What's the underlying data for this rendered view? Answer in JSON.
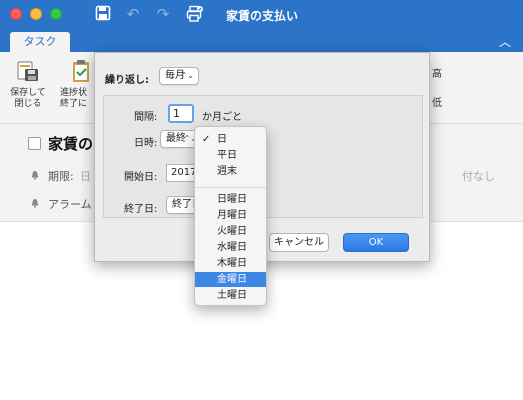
{
  "window": {
    "title": "家賃の支払い"
  },
  "ribbon": {
    "tab": "タスク",
    "save_close_line1": "保存して",
    "save_close_line2": "閉じる",
    "progress_line1": "進捗状",
    "progress_line2": "終了に",
    "priority_high": "高",
    "priority_low": "低",
    "collapse_icon": "chevron-up-icon"
  },
  "task": {
    "title": "家賃の",
    "due_label": "期限:",
    "due_value": "日",
    "due_right": "付なし",
    "alarm_label": "アラーム"
  },
  "dialog": {
    "repeat_label": "繰り返し:",
    "repeat_value": "毎月",
    "interval_label": "間隔:",
    "interval_value": "1",
    "interval_unit": "か月ごと",
    "date_label": "日時:",
    "date_value": "最終",
    "start_label": "開始日:",
    "start_value": "2017/",
    "end_label": "終了日:",
    "end_value": "終了日",
    "cancel_label": "キャンセル",
    "ok_label": "OK"
  },
  "menu": {
    "checked": "✓",
    "items": {
      "day": "日",
      "weekday": "平日",
      "weekend": "週末",
      "sunday": "日曜日",
      "monday": "月曜日",
      "tuesday": "火曜日",
      "wednesday": "水曜日",
      "thursday": "木曜日",
      "friday": "金曜日",
      "saturday": "土曜日"
    },
    "selected": "金曜日"
  },
  "colors": {
    "accent": "#2b74c7",
    "selection": "#3f87e7",
    "ok_button": "#2a7ae6"
  }
}
